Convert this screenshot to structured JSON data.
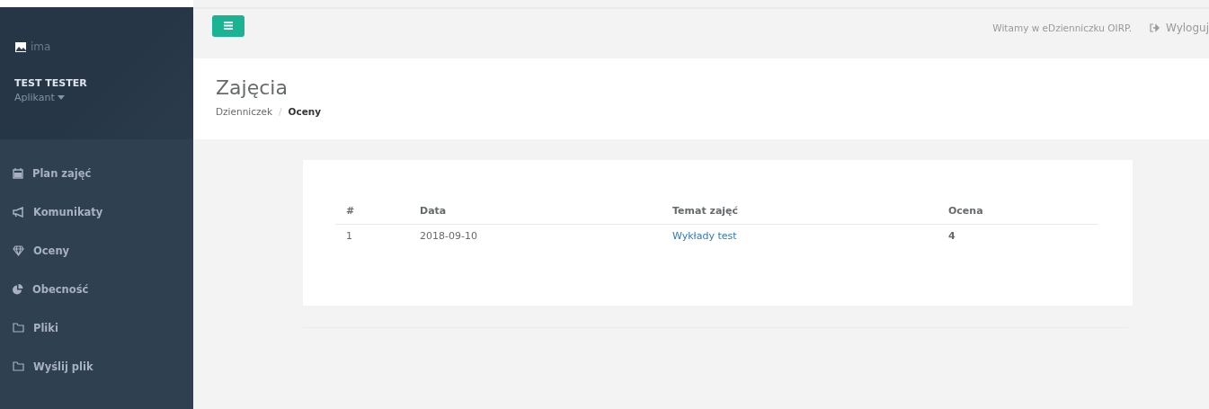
{
  "sidebar": {
    "logo_text": "ima",
    "user_name": "TEST TESTER",
    "user_role": "Aplikant",
    "items": [
      {
        "label": "Plan zajęć",
        "kind": "calendar"
      },
      {
        "label": "Komunikaty",
        "kind": "megaphone"
      },
      {
        "label": "Oceny",
        "kind": "diamond"
      },
      {
        "label": "Obecność",
        "kind": "pie"
      },
      {
        "label": "Pliki",
        "kind": "folder"
      },
      {
        "label": "Wyślij plik",
        "kind": "folder"
      }
    ]
  },
  "topbar": {
    "welcome": "Witamy w eDzienniczku OIRP.",
    "logout": "Wyloguj"
  },
  "header": {
    "title": "Zajęcia",
    "breadcrumb_separator": "/",
    "breadcrumbs": [
      {
        "label": "Dzienniczek",
        "selected": false
      },
      {
        "label": "Oceny",
        "selected": true
      }
    ]
  },
  "table": {
    "columns": [
      "#",
      "Data",
      "Temat zajęć",
      "Ocena"
    ],
    "rows": [
      {
        "cells": [
          "1",
          "2018-09-10",
          "Wykłady test",
          "4"
        ]
      }
    ]
  }
}
